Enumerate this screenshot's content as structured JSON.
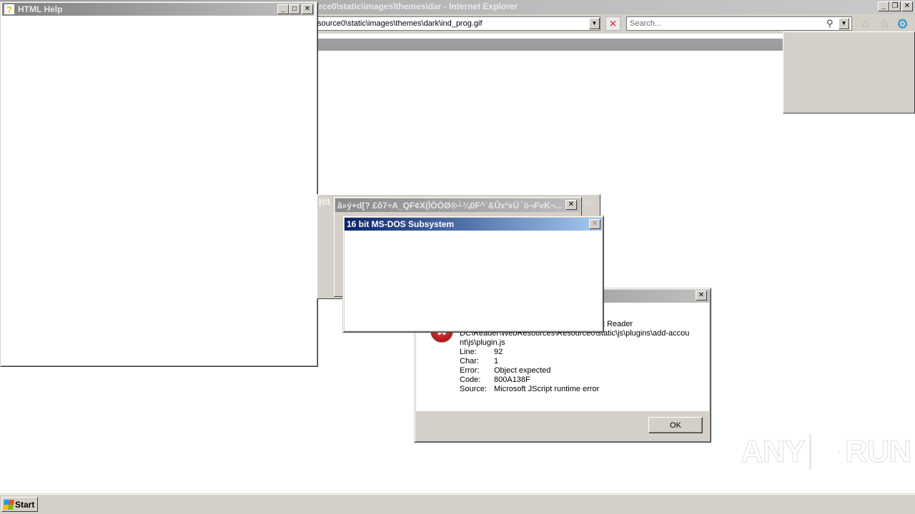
{
  "ie": {
    "title": "rce0\\static\\images\\themes\\dar - Internet Explorer",
    "address": "source0\\static\\images\\themes\\dark\\ind_prog.gif",
    "search_placeholder": "Search...",
    "icons": {
      "dropdown": "▼",
      "stop": "✕",
      "search": "⚲",
      "home": "⌂",
      "favorites": "☆",
      "tools": "⚙"
    },
    "caption": {
      "minimize": "_",
      "restore": "❐",
      "close": "✕"
    }
  },
  "help_window": {
    "title": "HTML Help",
    "icon": "?",
    "caption": {
      "minimize": "_",
      "maximize": "□",
      "close": "✕"
    }
  },
  "garbled_dialog": {
    "back_title_left": "|©\\",
    "back_title_right": "oL",
    "title": "ã»ý+d[? £ô7÷A_QF¢X(ÌÖÒØ®┴¼0F^`&Ûx²xÜ¯ö¬FvK¬...",
    "close": "✕"
  },
  "dos_dialog": {
    "title": "16 bit MS-DOS Subsystem",
    "close": "✕"
  },
  "script_error": {
    "close": "✕",
    "icon": "✖",
    "path_partial": "t Reader",
    "path_line2": "DC\\Reader\\WebResources\\Resource0\\static\\js\\plugins\\add-accou",
    "path_line3": "nt\\js\\plugin.js",
    "fields": [
      {
        "label": "Line:",
        "value": "92"
      },
      {
        "label": "Char:",
        "value": "1"
      },
      {
        "label": "Error:",
        "value": "Object expected"
      },
      {
        "label": "Code:",
        "value": "800A138F"
      },
      {
        "label": "Source:",
        "value": "Microsoft JScript runtime error"
      }
    ],
    "ok_label": "OK"
  },
  "taskbar": {
    "start_label": "Start"
  },
  "watermark": {
    "left": "ANY",
    "right": "RUN"
  }
}
